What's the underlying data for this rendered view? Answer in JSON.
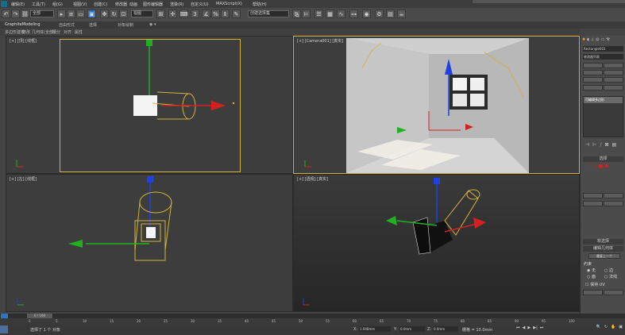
{
  "menubar": {
    "items": [
      "编辑(E)",
      "工具(T)",
      "组(G)",
      "视图(V)",
      "创建(C)",
      "修改器",
      "动画",
      "图形编辑器",
      "渲染(R)",
      "自定义(U)",
      "MAXScript(X)",
      "帮助(H)"
    ]
  },
  "toolbar": {
    "selection_filter": "全部",
    "coord_system": "视图",
    "named_selection": "创建选择集"
  },
  "ribbon": {
    "tabs": [
      "GraphiteModeling",
      "自由形式",
      "选择",
      "对象绘制"
    ],
    "subtabs": [
      "多边形建模",
      "修改",
      "几何体(全部)",
      "细分",
      "对齐",
      "属性"
    ]
  },
  "viewports": {
    "top_left": "[+] [顶] [线框]",
    "top_right": "[+] [Camera001] [真实]",
    "bottom_left": "[+] [左] [线框]",
    "bottom_right": "[+] [透视] [真实]"
  },
  "cmdpanel": {
    "object_name": "Rectangle001",
    "modifier_list": "修改器列表",
    "stack_item": "可编辑多边形",
    "section_select": "选择",
    "soft_select": "软选择",
    "edit_geometry": "编辑几何体",
    "repeat_last": "重复上一个",
    "constraints": "约束",
    "none": "无",
    "edge": "边",
    "face": "面",
    "normal": "法线",
    "preserve_uv": "保持 UV"
  },
  "timeline": {
    "frame_counter": "0 / 100",
    "ticks": [
      "0",
      "5",
      "10",
      "15",
      "20",
      "25",
      "30",
      "35",
      "40",
      "45",
      "50",
      "55",
      "60",
      "65",
      "70",
      "75",
      "80",
      "85",
      "90",
      "95",
      "100"
    ],
    "status_text": "选择了 1 个 对象",
    "x_value": "1.948mm",
    "y_value": "0.0mm",
    "z_value": "0.0mm",
    "grid": "栅格 = 10.0mm"
  },
  "colors": {
    "accent_yellow": "#d4b23a",
    "gizmo_x": "#d42020",
    "gizmo_y": "#20b020",
    "gizmo_z": "#2040e0",
    "viewport_bg": "#3d3d3d"
  }
}
